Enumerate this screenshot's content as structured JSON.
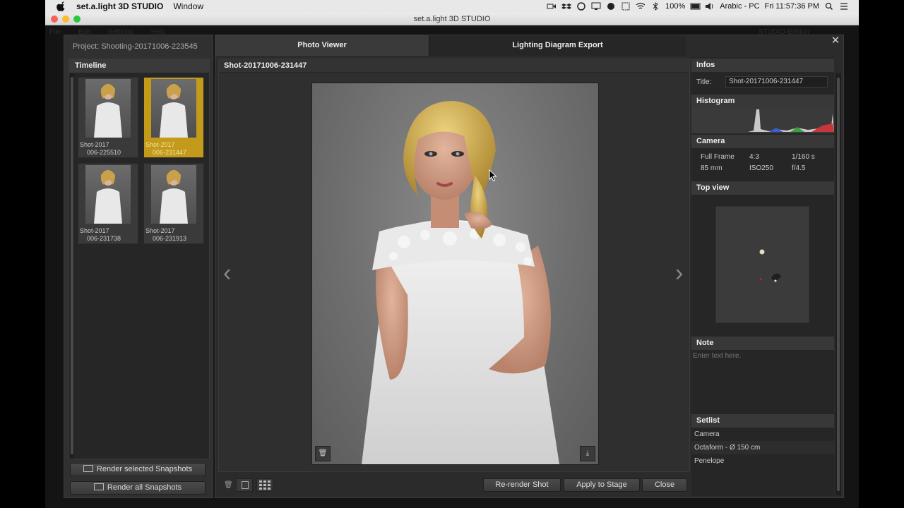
{
  "menubar": {
    "app_name": "set.a.light 3D STUDIO",
    "menu_window": "Window",
    "battery": "100%",
    "input_source": "Arabic - PC",
    "clock": "Fri 11:57:36 PM"
  },
  "window": {
    "title": "set.a.light 3D STUDIO"
  },
  "background_menu": {
    "items": [
      "File",
      "Edit",
      "Settings",
      "Help"
    ],
    "edition": "STUDIO-Edition"
  },
  "left_panel": {
    "project_label": "Project: Shooting-20171006-223545",
    "timeline_title": "Timeline",
    "thumbnails": [
      {
        "line1": "Shot-2017",
        "line2": "006-225510"
      },
      {
        "line1": "Shot-2017",
        "line2": "006-231447"
      },
      {
        "line1": "Shot-2017",
        "line2": "006-231738"
      },
      {
        "line1": "Shot-2017",
        "line2": "006-231913"
      }
    ],
    "render_selected_label": "Render selected Snapshots",
    "render_all_label": "Render all Snapshots"
  },
  "tabs": {
    "photo_viewer": "Photo Viewer",
    "lighting_export": "Lighting Diagram Export"
  },
  "viewer": {
    "shot_title": "Shot-20171006-231447"
  },
  "bottom_bar": {
    "rerender_label": "Re-render Shot",
    "apply_label": "Apply to Stage",
    "close_label": "Close"
  },
  "sidebar": {
    "infos_title": "Infos",
    "title_label": "Title:",
    "title_value": "Shot-20171006-231447",
    "histogram_title": "Histogram",
    "camera_title": "Camera",
    "camera": {
      "sensor": "Full Frame",
      "ratio": "4:3",
      "shutter": "1/160 s",
      "focal": "85 mm",
      "iso": "ISO250",
      "aperture": "f/4.5"
    },
    "topview_title": "Top view",
    "note_title": "Note",
    "note_placeholder": "Enter text here.",
    "setlist_title": "Setlist",
    "setlist_items": [
      "Camera",
      "Octaform - Ø 150 cm",
      "Penelope"
    ]
  },
  "colors": {
    "selection": "#c49a1a",
    "panel": "#2b2b2b",
    "header": "#3a3a3a"
  }
}
